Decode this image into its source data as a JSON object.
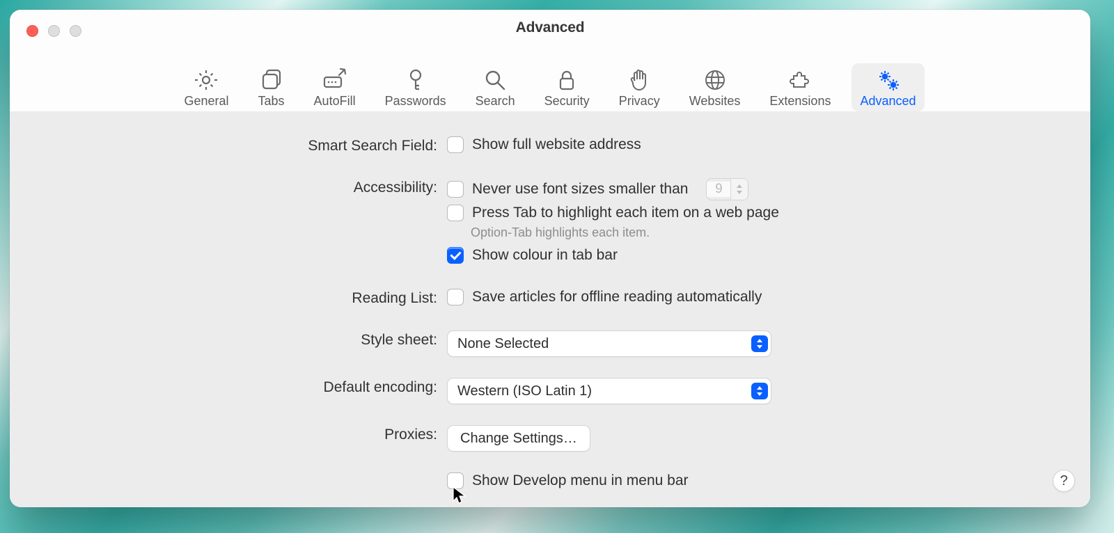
{
  "window": {
    "title": "Advanced"
  },
  "toolbar": {
    "items": [
      {
        "label": "General"
      },
      {
        "label": "Tabs"
      },
      {
        "label": "AutoFill"
      },
      {
        "label": "Passwords"
      },
      {
        "label": "Search"
      },
      {
        "label": "Security"
      },
      {
        "label": "Privacy"
      },
      {
        "label": "Websites"
      },
      {
        "label": "Extensions"
      },
      {
        "label": "Advanced"
      }
    ],
    "active_index": 9
  },
  "sections": {
    "smart_search": {
      "label": "Smart Search Field:",
      "show_full_address": {
        "label": "Show full website address",
        "checked": false
      }
    },
    "accessibility": {
      "label": "Accessibility:",
      "min_font": {
        "label": "Never use font sizes smaller than",
        "checked": false,
        "value": "9"
      },
      "press_tab": {
        "label": "Press Tab to highlight each item on a web page",
        "checked": false
      },
      "press_tab_hint": "Option-Tab highlights each item.",
      "show_colour": {
        "label": "Show colour in tab bar",
        "checked": true
      }
    },
    "reading_list": {
      "label": "Reading List:",
      "save_offline": {
        "label": "Save articles for offline reading automatically",
        "checked": false
      }
    },
    "style_sheet": {
      "label": "Style sheet:",
      "value": "None Selected"
    },
    "encoding": {
      "label": "Default encoding:",
      "value": "Western (ISO Latin 1)"
    },
    "proxies": {
      "label": "Proxies:",
      "button": "Change Settings…"
    },
    "develop": {
      "label": "Show Develop menu in menu bar",
      "checked": false
    }
  },
  "help_label": "?"
}
